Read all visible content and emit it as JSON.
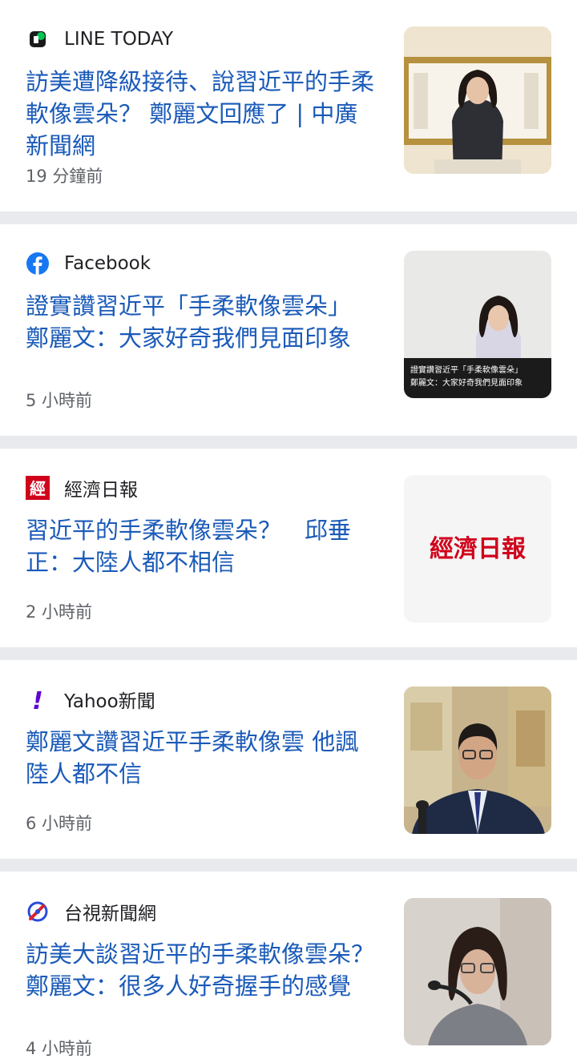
{
  "articles": [
    {
      "source": "LINE TODAY",
      "source_icon": "line-today-icon",
      "title": "訪美遭降級接待、說習近平的手柔軟像雲朵？ 鄭麗文回應了 | 中廣新聞網",
      "time": "19 分鐘前"
    },
    {
      "source": "Facebook",
      "source_icon": "facebook-icon",
      "title": "證實讚習近平「手柔軟像雲朵」 鄭麗文：大家好奇我們見面印象",
      "time": "5 小時前",
      "thumbnail_caption_line1": "證實讚習近平「手柔軟像雲朵」",
      "thumbnail_caption_line2": "鄭麗文：大家好奇我們見面印象"
    },
    {
      "source": "經濟日報",
      "source_icon": "economic-daily-icon",
      "title": "習近平的手柔軟像雲朵？　邱垂正：大陸人都不相信",
      "time": "2 小時前",
      "thumbnail_logo_text": "經濟日報",
      "source_icon_text": "經"
    },
    {
      "source": "Yahoo新聞",
      "source_icon": "yahoo-news-icon",
      "title": "鄭麗文讚習近平手柔軟像雲 他諷陸人都不信",
      "time": "6 小時前",
      "source_icon_text": "!"
    },
    {
      "source": "台視新聞網",
      "source_icon": "ttv-news-icon",
      "title": "訪美大談習近平的手柔軟像雲朵？ 鄭麗文：很多人好奇握手的感覺",
      "time": "4 小時前"
    }
  ],
  "colors": {
    "title": "#1a5ab8",
    "time": "#5f6368",
    "divider": "#e8eaed",
    "line_green": "#06c755",
    "facebook_blue": "#1877f2",
    "udn_red": "#d0021b",
    "yahoo_purple": "#6001d2"
  }
}
